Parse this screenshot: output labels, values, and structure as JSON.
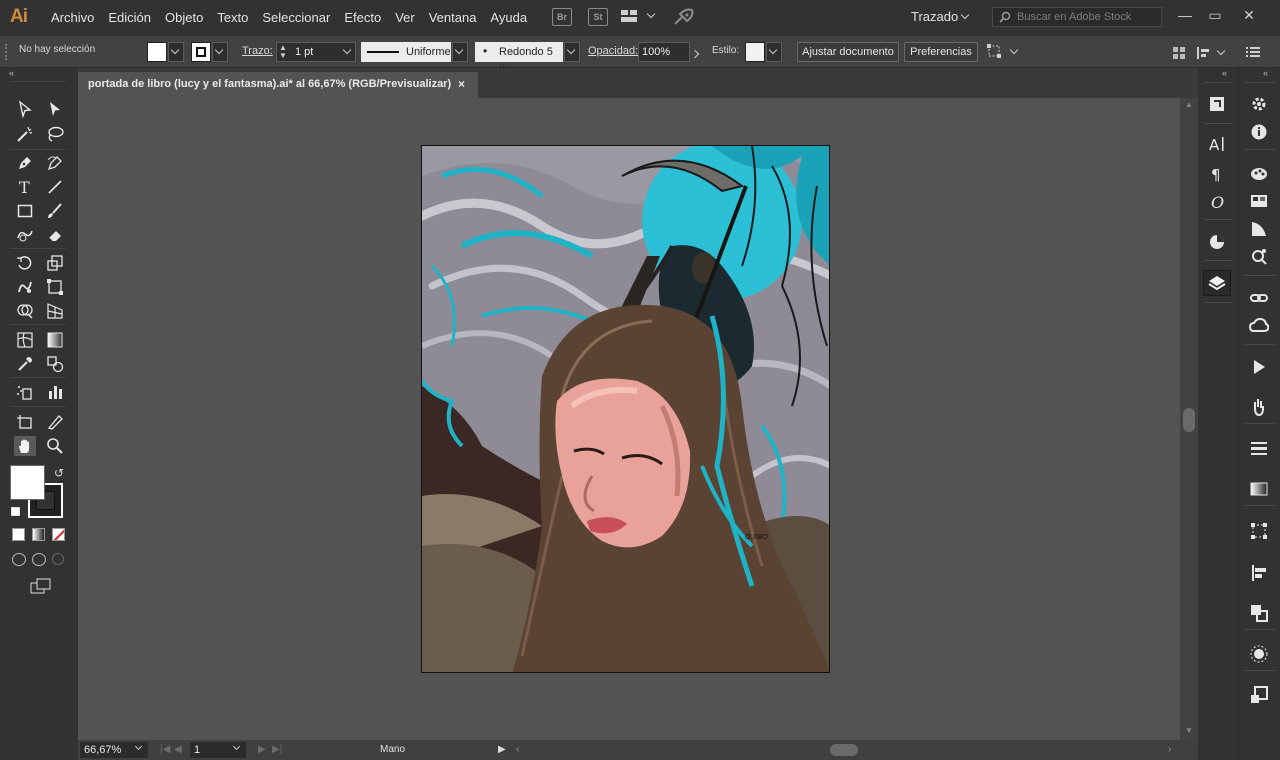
{
  "app": {
    "logo": "Ai",
    "menu": [
      "Archivo",
      "Edición",
      "Objeto",
      "Texto",
      "Seleccionar",
      "Efecto",
      "Ver",
      "Ventana",
      "Ayuda"
    ],
    "bridge_label": "Br",
    "stock_label": "St",
    "workspace": "Trazado",
    "search_placeholder": "Buscar en Adobe Stock"
  },
  "control": {
    "selection": "No hay selección",
    "stroke_label": "Trazo:",
    "stroke_weight": "1 pt",
    "profile": "Uniforme",
    "brush": "Redondo 5 ...",
    "opacity_label": "Opacidad:",
    "opacity_value": "100%",
    "style_label": "Estilo:",
    "adjust_button": "Ajustar documento",
    "prefs_button": "Preferencias"
  },
  "document": {
    "tab_title": "portada de libro (lucy y el fantasma).ai* al 66,67% (RGB/Previsualizar)",
    "close": "×",
    "signature": "Q.XBO"
  },
  "status": {
    "zoom": "66,67%",
    "page": "1",
    "mode": "Mano"
  },
  "colors": {
    "accent_cyan": "#1fb3c7",
    "hair": "#5a4332",
    "skin": "#e8a29a",
    "sky": "#8f8d96",
    "ui_dark": "#323232",
    "canvas_bg": "#535353"
  },
  "icons": {
    "tools": [
      "selection-icon",
      "direct-selection-icon",
      "magic-wand-icon",
      "lasso-icon",
      "pen-icon",
      "curvature-icon",
      "type-icon",
      "line-icon",
      "rectangle-icon",
      "paintbrush-icon",
      "shaper-icon",
      "eraser-icon",
      "rotate-icon",
      "scale-icon",
      "warp-icon",
      "free-transform-icon",
      "shape-builder-icon",
      "perspective-icon",
      "mesh-icon",
      "gradient-icon",
      "eyedropper-icon",
      "blend-icon",
      "symbol-sprayer-icon",
      "graph-icon",
      "artboard-icon",
      "slice-icon",
      "hand-icon",
      "zoom-icon"
    ],
    "right_mid": [
      "libraries-icon",
      "character-icon",
      "paragraph-icon",
      "opentype-icon",
      "color-guide-icon",
      "layers-icon"
    ],
    "right_far": [
      "properties-icon",
      "info-icon",
      "color-icon",
      "swatches-icon",
      "brushes-icon",
      "symbols-icon",
      "links-icon",
      "creative-cloud-icon",
      "actions-icon",
      "puppet-icon",
      "stroke-icon",
      "gradient-panel-icon",
      "transform-icon",
      "align-icon",
      "pathfinder-icon",
      "appearance-icon",
      "export-icon"
    ]
  }
}
